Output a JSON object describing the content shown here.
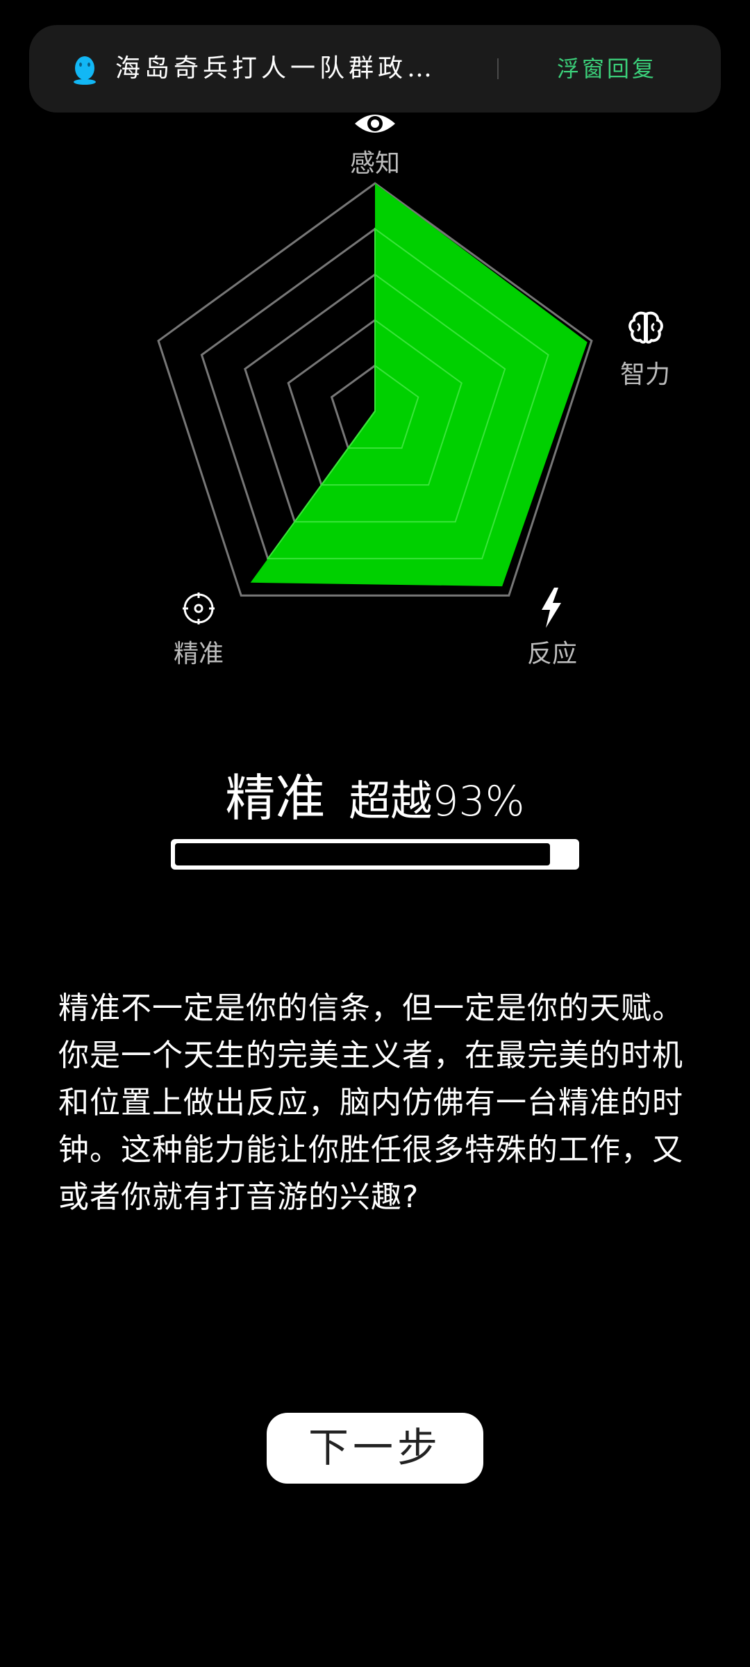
{
  "notification": {
    "sender_text": "海岛奇兵打人一队群政…",
    "action_label": "浮窗回复",
    "icon": "qq-penguin-icon",
    "action_color": "#3bd07a"
  },
  "chart_data": {
    "type": "radar",
    "axes": [
      {
        "label": "感知",
        "icon": "eye-icon",
        "value": 1.0
      },
      {
        "label": "智力",
        "icon": "brain-icon",
        "value": 0.98
      },
      {
        "label": "反应",
        "icon": "lightning-bolt-icon",
        "value": 0.95
      },
      {
        "label": "精准",
        "icon": "crosshair-icon",
        "value": 0.93
      }
    ],
    "rings": 5,
    "fill_color": "#00d000",
    "grid_color": "#777777"
  },
  "result": {
    "category": "精准",
    "percentile_text": "超越93%",
    "percentile": 0.93
  },
  "description": "精准不一定是你的信条，但一定是你的天赋。你是一个天生的完美主义者，在最完美的时机和位置上做出反应，脑内仿佛有一台精准的时钟。这种能力能让你胜任很多特殊的工作，又或者你就有打音游的兴趣?",
  "next_button": {
    "label": "下一步"
  }
}
